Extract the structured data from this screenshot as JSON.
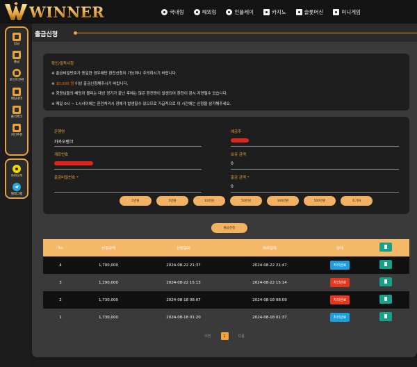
{
  "brand": {
    "name": "WINNER",
    "gold": "#e8a33b"
  },
  "nav": [
    {
      "label": "국내형",
      "icon": "soccer-ball-icon"
    },
    {
      "label": "해외형",
      "icon": "soccer-ball-icon"
    },
    {
      "label": "인플레이",
      "icon": "soccer-ball-icon"
    },
    {
      "label": "카지노",
      "icon": "monitor-icon"
    },
    {
      "label": "슬롯머신",
      "icon": "slot-icon"
    },
    {
      "label": "미니게임",
      "icon": "minigame-icon"
    }
  ],
  "sidebar": {
    "items": [
      {
        "label": "입금",
        "icon": "wallet-icon"
      },
      {
        "label": "출금",
        "icon": "atm-icon"
      },
      {
        "label": "포인트전환",
        "icon": "point-icon"
      },
      {
        "label": "베팅내역",
        "icon": "ticket-icon"
      },
      {
        "label": "출석체크",
        "icon": "calendar-icon"
      },
      {
        "label": "지인추천",
        "icon": "gift-icon"
      }
    ],
    "contacts": [
      {
        "label": "카카오톡",
        "icon": "kakaotalk-icon"
      },
      {
        "label": "텔레그램",
        "icon": "telegram-icon"
      }
    ]
  },
  "page": {
    "title": "출금신청"
  },
  "notice": {
    "heading": "확인/필독사항",
    "lines": [
      {
        "pre": "※ 출금비밀번호가 동일한 경우에만 환전신청이 가능하니 주의하시기 바랍니다.",
        "hl": "",
        "post": ""
      },
      {
        "pre": "※ ",
        "hl": "10,000 원",
        "post": " 이상 출금신청해주시기 바랍니다."
      },
      {
        "pre": "※ 회원님들의 배팅이 몰리는 대상 경기가 끝난 후에는 많은 환전량이 발생되어 환전이 잠시 지연될수 있습니다.",
        "hl": "",
        "post": ""
      },
      {
        "pre": "※ 매일 0시 ~ 1시사이에는 환전처리시 장애가 발생할수 있으므로 가급적으로 이 시간에는 신청을 삼가해주세요.",
        "hl": "",
        "post": ""
      }
    ]
  },
  "form": {
    "bank_label": "은행명",
    "bank_value": "카카오뱅크",
    "holder_label": "예금주",
    "account_label": "계좌번호",
    "balance_label": "보유 금액",
    "balance_value": "0",
    "password_label": "출금비밀번호 *",
    "amount_label": "출금 금액 *",
    "amount_value": "0"
  },
  "amount_buttons": [
    "1만원",
    "5만원",
    "10만원",
    "50만원",
    "100만원",
    "500만원",
    "초기화"
  ],
  "submit_label": "출금신청",
  "table": {
    "headers": [
      "No.",
      "신청금액",
      "신청일자",
      "처리일자",
      "상태"
    ],
    "rows": [
      {
        "no": "4",
        "amount": "1,700,000",
        "applied": "2024-08-22 21:37",
        "processed": "2024-08-22 21:47",
        "status": "처리완료",
        "status_color": "#1b9ede"
      },
      {
        "no": "3",
        "amount": "1,290,000",
        "applied": "2024-08-22 15:13",
        "processed": "2024-08-22 15:14",
        "status": "처리완료",
        "status_color": "#e8361a"
      },
      {
        "no": "2",
        "amount": "1,730,000",
        "applied": "2024-08-18 08:07",
        "processed": "2024-08-18 08:09",
        "status": "처리완료",
        "status_color": "#e8361a"
      },
      {
        "no": "1",
        "amount": "1,730,000",
        "applied": "2024-08-18 01:20",
        "processed": "2024-08-18 01:37",
        "status": "처리완료",
        "status_color": "#1b9ede"
      }
    ]
  },
  "pager": {
    "prev": "이전",
    "current": "1",
    "next": "다음"
  }
}
